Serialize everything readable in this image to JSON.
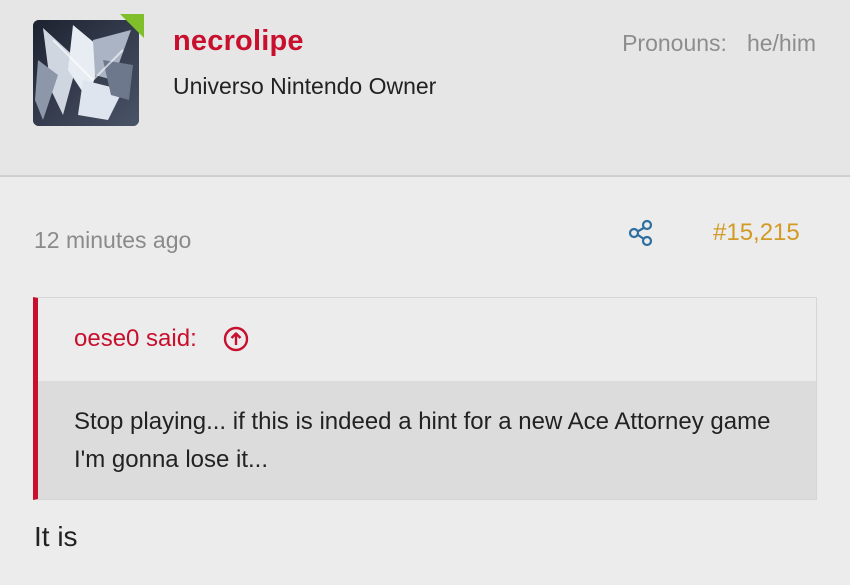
{
  "user": {
    "name": "necrolipe",
    "title": "Universo Nintendo Owner",
    "pronouns_label": "Pronouns:",
    "pronouns_value": "he/him"
  },
  "post": {
    "time": "12 minutes ago",
    "number": "#15,215"
  },
  "quote": {
    "author_line": "oese0 said:",
    "text": "Stop playing... if this is indeed a hint for a new Ace Attorney game I'm gonna lose it..."
  },
  "reply": {
    "text": "It is"
  },
  "colors": {
    "accent_red": "#c8102e",
    "post_number_gold": "#d29b25",
    "share_icon_blue": "#2e6f9e",
    "online_green": "#7fbf2a"
  },
  "icons": {
    "share": "share-icon",
    "quote_jump": "arrow-up-circle-icon"
  }
}
